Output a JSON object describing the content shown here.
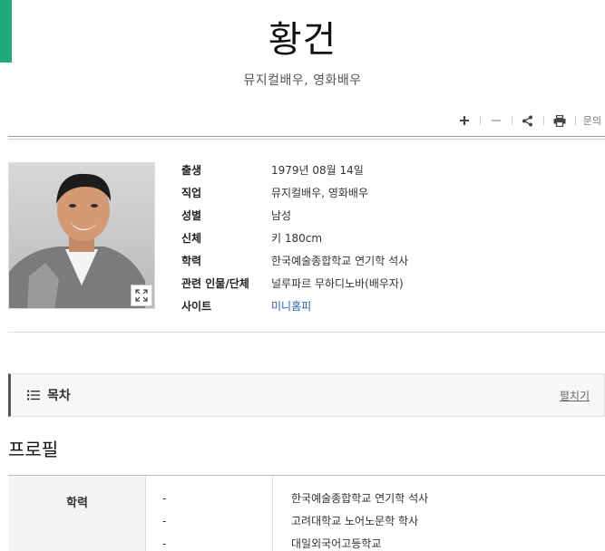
{
  "header": {
    "title": "황건",
    "subtitle": "뮤지컬배우, 영화배우"
  },
  "toolbar": {
    "inquiry_label": "문의"
  },
  "infobox": {
    "rows": [
      {
        "label": "출생",
        "value": "1979년 08월 14일"
      },
      {
        "label": "직업",
        "value": "뮤지컬배우, 영화배우"
      },
      {
        "label": "성별",
        "value": "남성"
      },
      {
        "label": "신체",
        "value": "키 180cm"
      },
      {
        "label": "학력",
        "value": "한국예술종합학교 연기학 석사"
      },
      {
        "label": "관련 인물/단체",
        "value": "널루파르 무하디노바(배우자)"
      },
      {
        "label": "사이트",
        "value": "미니홈피"
      }
    ]
  },
  "toc": {
    "title": "목차",
    "expand_label": "펼치기"
  },
  "profile": {
    "section_title": "프로필",
    "education_label": "학력",
    "education_rows": [
      {
        "date": "-",
        "value": "한국예술종합학교 연기학 석사"
      },
      {
        "date": "-",
        "value": "고려대학교 노어노문학 학사"
      },
      {
        "date": "-",
        "value": "대일외국어고등학교"
      }
    ]
  },
  "colors": {
    "accent": "#1fa87a",
    "link": "#2563a8"
  },
  "icons": [
    "plus-icon",
    "minus-icon",
    "share-icon",
    "print-icon",
    "expand-icon",
    "list-icon"
  ]
}
